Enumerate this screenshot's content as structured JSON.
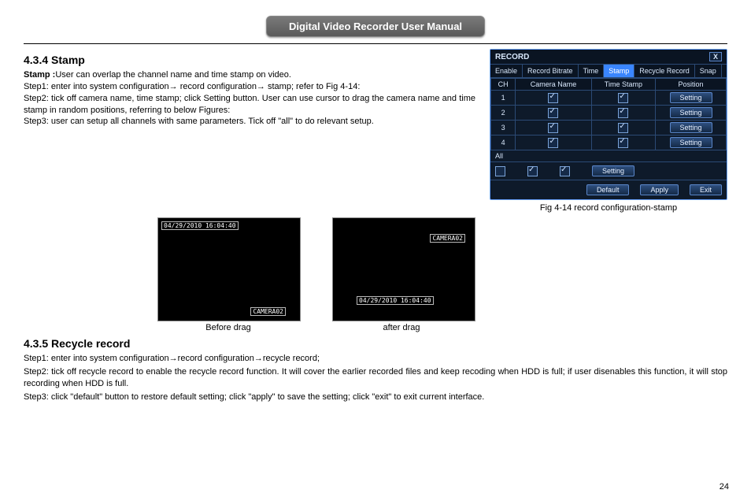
{
  "header": {
    "title": "Digital Video Recorder User Manual"
  },
  "sec1": {
    "heading": "4.3.4  Stamp",
    "intro_bold": "Stamp :",
    "intro_rest": "User can overlap the channel name and time stamp on video.",
    "step1": "Step1: enter into system configuration→ record configuration→ stamp; refer to Fig 4-14:",
    "step2": "Step2: tick off camera name, time stamp; click Setting button. User can use cursor to drag the camera name and time stamp in random positions, referring to below Figures:",
    "step3": "Step3: user can setup all channels with same parameters. Tick off \"all\" to do relevant setup."
  },
  "record_win": {
    "title": "RECORD",
    "close": "X",
    "tabs": [
      "Enable",
      "Record Bitrate",
      "Time",
      "Stamp",
      "Recycle Record",
      "Snap"
    ],
    "active_tab_index": 3,
    "cols": [
      "CH",
      "Camera Name",
      "Time Stamp",
      "Position"
    ],
    "rows": [
      {
        "ch": "1",
        "setting": "Setting"
      },
      {
        "ch": "2",
        "setting": "Setting"
      },
      {
        "ch": "3",
        "setting": "Setting"
      },
      {
        "ch": "4",
        "setting": "Setting"
      }
    ],
    "all_label": "All",
    "all_setting": "Setting",
    "footer": {
      "default": "Default",
      "apply": "Apply",
      "exit": "Exit"
    },
    "caption": "Fig 4-14 record configuration-stamp"
  },
  "thumbs": {
    "before": {
      "ts": "04/29/2010  16:04:40",
      "cam": "CAMERA02",
      "label": "Before drag"
    },
    "after": {
      "ts": "04/29/2010  16:04:40",
      "cam": "CAMERA02",
      "label": "after drag"
    }
  },
  "sec2": {
    "heading": "4.3.5  Recycle record",
    "step1": "Step1: enter into system configuration→record configuration→recycle record;",
    "step2": "Step2: tick off recycle record to enable the recycle record function. It will cover the earlier recorded files and keep recoding when HDD is full; if user disenables this function, it will stop recording when HDD is full.",
    "step3": "Step3: click \"default\" button to restore default setting; click \"apply\" to save the setting; click \"exit\" to exit current interface."
  },
  "page_number": "24"
}
